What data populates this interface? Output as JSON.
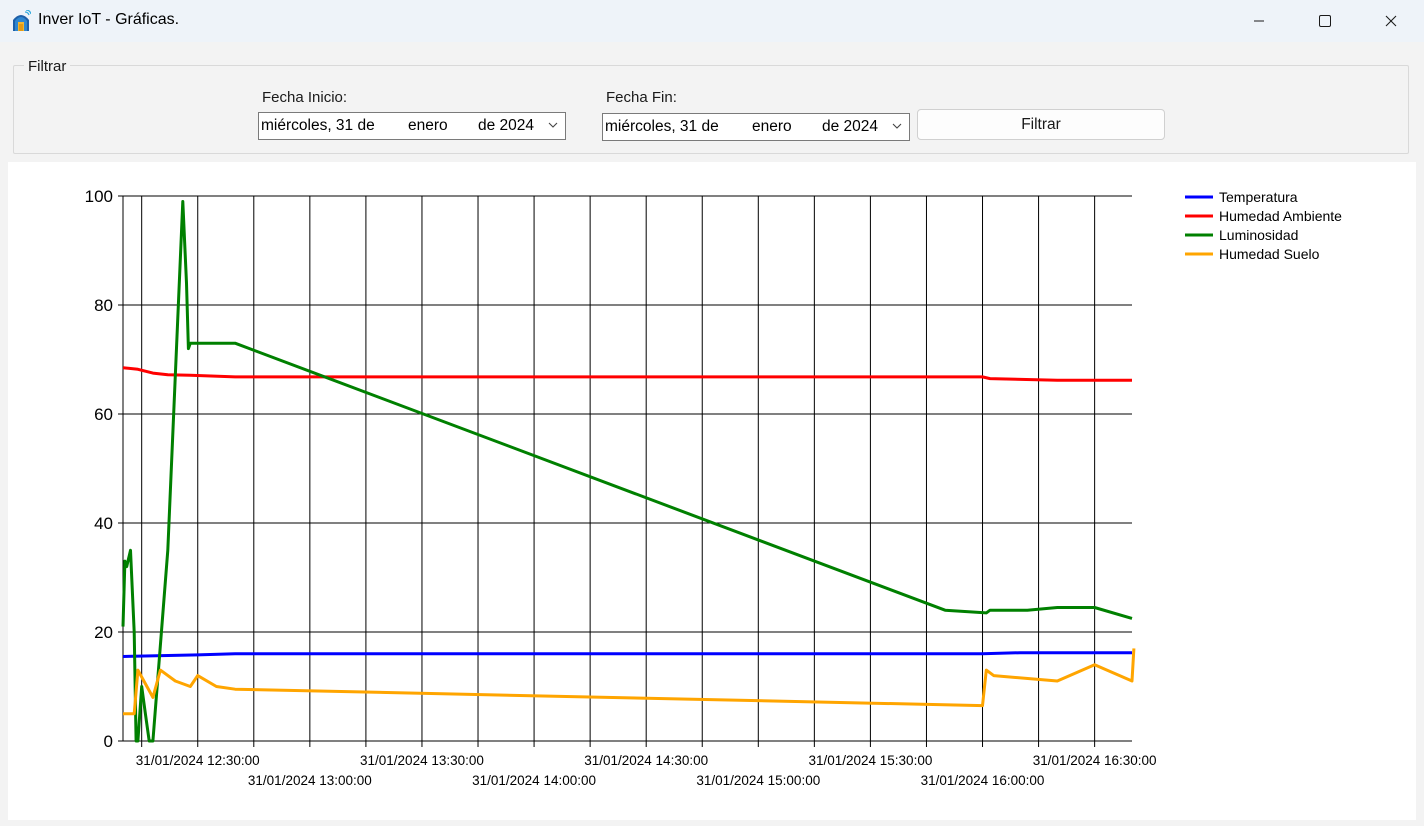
{
  "window": {
    "title": "Inver IoT - Gráficas.",
    "icon": "greenhouse-icon"
  },
  "filter": {
    "group_label": "Filtrar",
    "start_label": "Fecha Inicio:",
    "end_label": "Fecha Fin:",
    "start_date": {
      "weekday": "miércoles, 31 de",
      "month": "enero",
      "year": "de 2024"
    },
    "end_date": {
      "weekday": "miércoles, 31 de",
      "month": "enero",
      "year": "de 2024"
    },
    "button_label": "Filtrar"
  },
  "chart_data": {
    "type": "line",
    "title": "",
    "xlabel": "",
    "ylabel": "",
    "ylim": [
      0,
      100
    ],
    "xlim": [
      "31/01/2024 12:10:00",
      "31/01/2024 16:40:00"
    ],
    "grid": true,
    "legend_position": "top-right",
    "y_ticks": [
      "0",
      "20",
      "40",
      "60",
      "80",
      "100"
    ],
    "x_ticks_upper": [
      "31/01/2024 12:30:00",
      "31/01/2024 13:30:00",
      "31/01/2024 14:30:00",
      "31/01/2024 15:30:00",
      "31/01/2024 16:30:00"
    ],
    "x_ticks_lower": [
      "31/01/2024 13:00:00",
      "31/01/2024 14:00:00",
      "31/01/2024 15:00:00",
      "31/01/2024 16:00:00"
    ],
    "series": [
      {
        "name": "Temperatura",
        "color": "#0000ff",
        "x": [
          "12:10:00",
          "12:30:00",
          "12:40:00",
          "16:00:00",
          "16:10:00",
          "16:40:00"
        ],
        "values": [
          15.5,
          15.8,
          16.0,
          16.0,
          16.2,
          16.2
        ]
      },
      {
        "name": "Humedad Ambiente",
        "color": "#ff0000",
        "x": [
          "12:10:00",
          "12:14:00",
          "12:18:00",
          "12:22:00",
          "12:28:00",
          "12:40:00",
          "16:00:00",
          "16:02:00",
          "16:20:00",
          "16:40:00"
        ],
        "values": [
          68.5,
          68.2,
          67.5,
          67.2,
          67.1,
          66.8,
          66.8,
          66.5,
          66.2,
          66.2
        ]
      },
      {
        "name": "Luminosidad",
        "color": "#008000",
        "x": [
          "12:10:00",
          "12:10:30",
          "12:11:00",
          "12:12:00",
          "12:13:00",
          "12:13:30",
          "12:14:00",
          "12:15:00",
          "12:16:00",
          "12:17:00",
          "12:18:00",
          "12:22:00",
          "12:26:00",
          "12:27:00",
          "12:27:30",
          "12:28:00",
          "12:30:00",
          "12:40:00",
          "15:50:00",
          "16:01:00",
          "16:02:00",
          "16:03:00",
          "16:12:00",
          "16:20:00",
          "16:30:00",
          "16:40:00"
        ],
        "values": [
          21,
          33,
          32,
          35,
          20,
          0,
          0,
          10,
          5,
          0,
          0,
          35,
          99,
          84,
          72,
          73,
          73,
          73,
          24,
          23.5,
          24,
          24,
          24,
          24.5,
          24.5,
          22.5
        ]
      },
      {
        "name": "Humedad Suelo",
        "color": "#ffa500",
        "x": [
          "12:10:00",
          "12:13:00",
          "12:14:00",
          "12:18:00",
          "12:20:00",
          "12:24:00",
          "12:28:00",
          "12:30:00",
          "12:35:00",
          "12:40:00",
          "16:00:00",
          "16:01:00",
          "16:03:00",
          "16:20:00",
          "16:30:00",
          "16:40:00",
          "16:40:30"
        ],
        "values": [
          5,
          5,
          13,
          8,
          13,
          11,
          10,
          12,
          10,
          9.5,
          6.5,
          13,
          12,
          11,
          14,
          11,
          17
        ]
      }
    ]
  }
}
